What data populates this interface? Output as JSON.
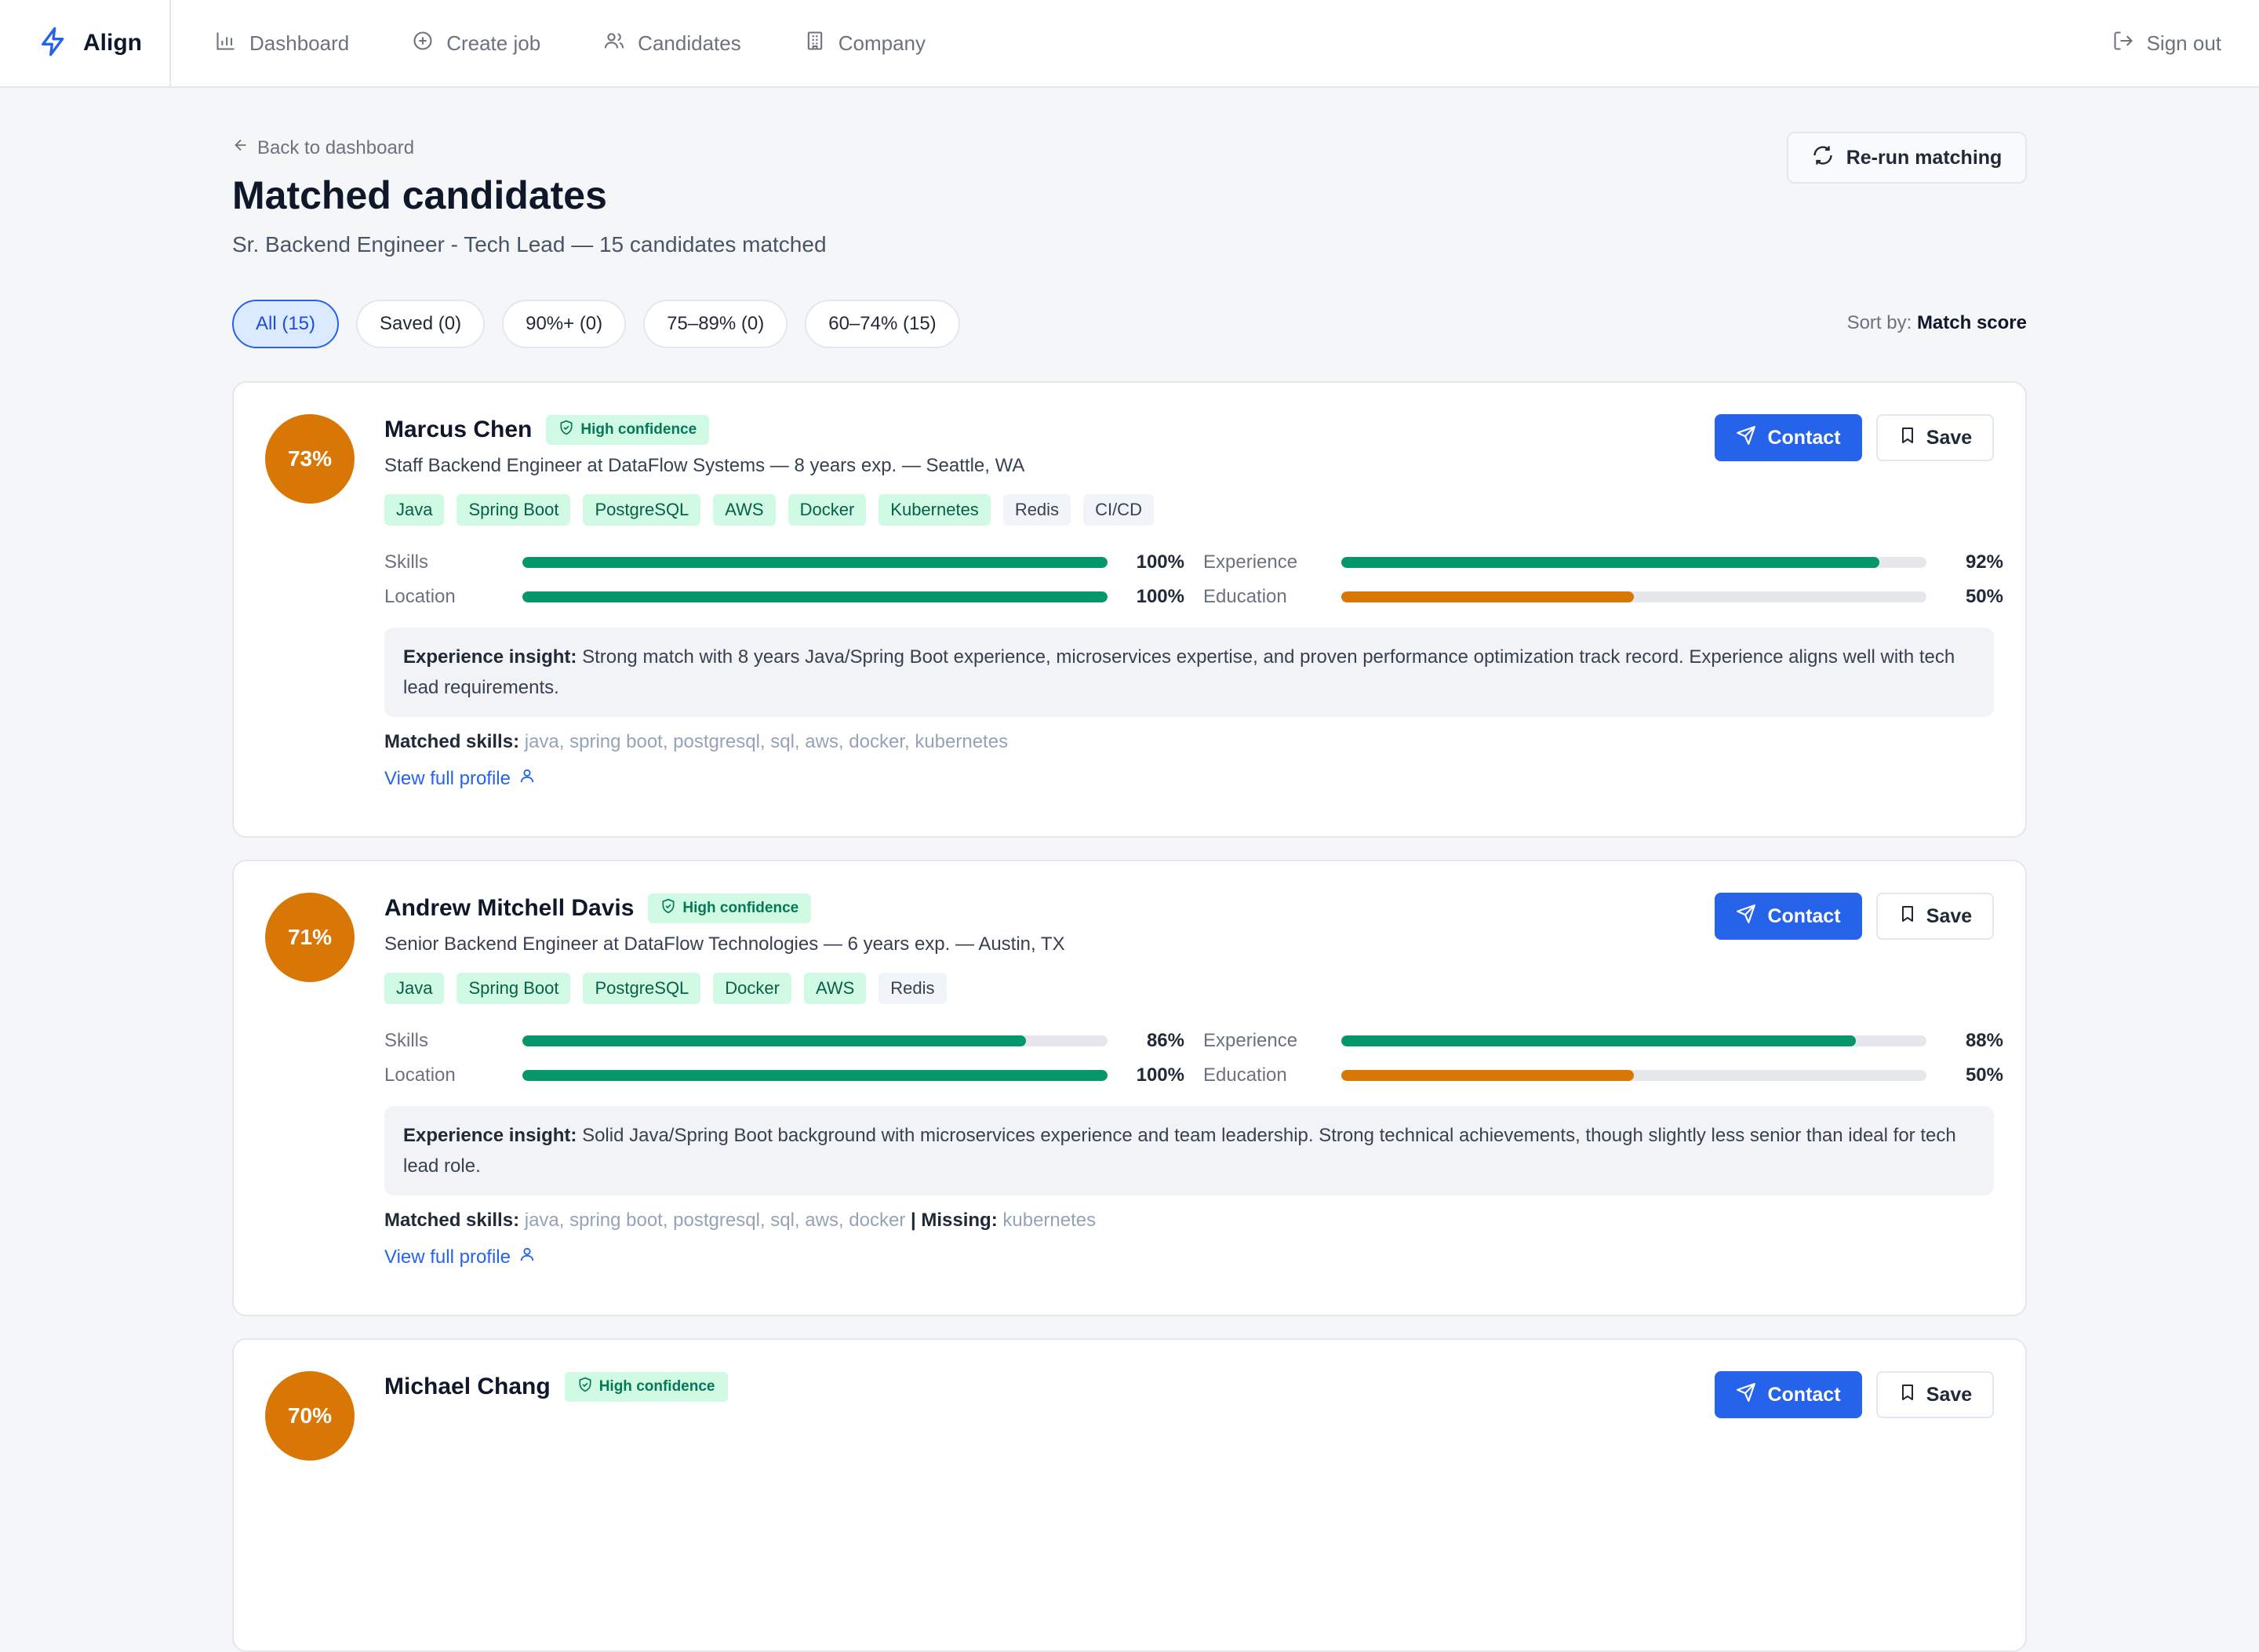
{
  "brand": {
    "name": "Align"
  },
  "nav": [
    {
      "label": "Dashboard",
      "icon": "bar-chart-icon"
    },
    {
      "label": "Create job",
      "icon": "plus-circle-icon"
    },
    {
      "label": "Candidates",
      "icon": "users-icon"
    },
    {
      "label": "Company",
      "icon": "building-icon"
    }
  ],
  "signout": "Sign out",
  "header": {
    "back": "Back to dashboard",
    "title": "Matched candidates",
    "subtitle": "Sr. Backend Engineer - Tech Lead — 15 candidates matched",
    "rerun": "Re-run matching"
  },
  "filters": [
    {
      "label": "All (15)",
      "active": true
    },
    {
      "label": "Saved (0)",
      "active": false
    },
    {
      "label": "90%+ (0)",
      "active": false
    },
    {
      "label": "75–89% (0)",
      "active": false
    },
    {
      "label": "60–74% (15)",
      "active": false
    }
  ],
  "sort": {
    "label": "Sort by:",
    "value": "Match score"
  },
  "candidates": [
    {
      "score": "73%",
      "name": "Marcus Chen",
      "confidence": "High confidence",
      "role": "Staff Backend Engineer at DataFlow Systems — 8 years exp. — Seattle, WA",
      "tags": [
        {
          "label": "Java",
          "matched": true
        },
        {
          "label": "Spring Boot",
          "matched": true
        },
        {
          "label": "PostgreSQL",
          "matched": true
        },
        {
          "label": "AWS",
          "matched": true
        },
        {
          "label": "Docker",
          "matched": true
        },
        {
          "label": "Kubernetes",
          "matched": true
        },
        {
          "label": "Redis",
          "matched": false
        },
        {
          "label": "CI/CD",
          "matched": false
        }
      ],
      "metrics": [
        {
          "label": "Skills",
          "value": "100%",
          "pct": 100,
          "color": "#059669"
        },
        {
          "label": "Experience",
          "value": "92%",
          "pct": 92,
          "color": "#059669"
        },
        {
          "label": "Location",
          "value": "100%",
          "pct": 100,
          "color": "#059669"
        },
        {
          "label": "Education",
          "value": "50%",
          "pct": 50,
          "color": "#d97706"
        }
      ],
      "insight_label": "Experience insight:",
      "insight": "Strong match with 8 years Java/Spring Boot experience, microservices expertise, and proven performance optimization track record. Experience aligns well with tech lead requirements.",
      "matched_label": "Matched skills:",
      "matched": "java, spring boot, postgresql, sql, aws, docker, kubernetes",
      "missing_label": "",
      "missing": "",
      "view_profile": "View full profile",
      "contact": "Contact",
      "save": "Save"
    },
    {
      "score": "71%",
      "name": "Andrew Mitchell Davis",
      "confidence": "High confidence",
      "role": "Senior Backend Engineer at DataFlow Technologies — 6 years exp. — Austin, TX",
      "tags": [
        {
          "label": "Java",
          "matched": true
        },
        {
          "label": "Spring Boot",
          "matched": true
        },
        {
          "label": "PostgreSQL",
          "matched": true
        },
        {
          "label": "Docker",
          "matched": true
        },
        {
          "label": "AWS",
          "matched": true
        },
        {
          "label": "Redis",
          "matched": false
        }
      ],
      "metrics": [
        {
          "label": "Skills",
          "value": "86%",
          "pct": 86,
          "color": "#059669"
        },
        {
          "label": "Experience",
          "value": "88%",
          "pct": 88,
          "color": "#059669"
        },
        {
          "label": "Location",
          "value": "100%",
          "pct": 100,
          "color": "#059669"
        },
        {
          "label": "Education",
          "value": "50%",
          "pct": 50,
          "color": "#d97706"
        }
      ],
      "insight_label": "Experience insight:",
      "insight": "Solid Java/Spring Boot background with microservices experience and team leadership. Strong technical achievements, though slightly less senior than ideal for tech lead role.",
      "matched_label": "Matched skills:",
      "matched": "java, spring boot, postgresql, sql, aws, docker",
      "missing_label": "| Missing:",
      "missing": "kubernetes",
      "view_profile": "View full profile",
      "contact": "Contact",
      "save": "Save"
    },
    {
      "score": "70%",
      "name": "Michael Chang",
      "confidence": "High confidence",
      "contact": "Contact",
      "save": "Save"
    }
  ]
}
